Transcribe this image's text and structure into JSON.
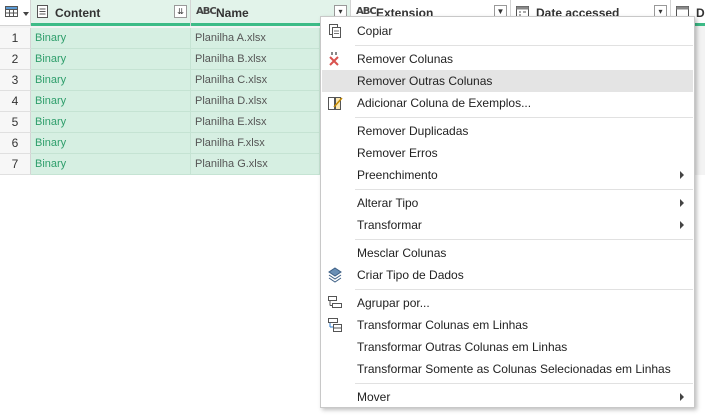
{
  "columns": [
    {
      "name": "Content",
      "type_icon": "table-cell-icon",
      "filter_icon": "expand-icon"
    },
    {
      "name": "Name",
      "type_icon": "abc-text-icon",
      "filter_icon": "dropdown-icon"
    },
    {
      "name": "Extension",
      "type_icon": "abc-text-icon",
      "filter_icon": "filter-icon"
    },
    {
      "name": "Date accessed",
      "type_icon": "calendar-icon",
      "filter_icon": "dropdown-icon"
    },
    {
      "name": "Da",
      "type_icon": "calendar-icon"
    }
  ],
  "type_text": {
    "abc": "ABC"
  },
  "rows": [
    {
      "index": "1",
      "content": "Binary",
      "name": "Planilha A.xlsx"
    },
    {
      "index": "2",
      "content": "Binary",
      "name": "Planilha B.xlsx"
    },
    {
      "index": "3",
      "content": "Binary",
      "name": "Planilha C.xlsx"
    },
    {
      "index": "4",
      "content": "Binary",
      "name": "Planilha D.xlsx"
    },
    {
      "index": "5",
      "content": "Binary",
      "name": "Planilha E.xlsx"
    },
    {
      "index": "6",
      "content": "Binary",
      "name": "Planilha F.xlsx"
    },
    {
      "index": "7",
      "content": "Binary",
      "name": "Planilha G.xlsx"
    }
  ],
  "menu": {
    "items": [
      {
        "label": "Copiar",
        "icon": "copy-icon"
      },
      {
        "label": "Remover Colunas",
        "icon": "remove-columns-icon"
      },
      {
        "label": "Remover Outras Colunas",
        "highlighted": true
      },
      {
        "label": "Adicionar Coluna de Exemplos...",
        "icon": "column-from-examples-icon"
      },
      {
        "label": "Remover Duplicadas"
      },
      {
        "label": "Remover Erros"
      },
      {
        "label": "Preenchimento",
        "submenu": true
      },
      {
        "label": "Alterar Tipo",
        "submenu": true
      },
      {
        "label": "Transformar",
        "submenu": true
      },
      {
        "label": "Mesclar Colunas"
      },
      {
        "label": "Criar Tipo de Dados",
        "icon": "data-type-icon"
      },
      {
        "label": "Agrupar por...",
        "icon": "group-by-icon"
      },
      {
        "label": "Transformar Colunas em Linhas",
        "icon": "unpivot-icon"
      },
      {
        "label": "Transformar Outras Colunas em Linhas"
      },
      {
        "label": "Transformar Somente as Colunas Selecionadas em Linhas"
      },
      {
        "label": "Mover",
        "submenu": true
      }
    ]
  },
  "colors": {
    "selected_column": "#d6efe2",
    "accent": "#3dbb87",
    "binary_text": "#2e9e6b"
  }
}
